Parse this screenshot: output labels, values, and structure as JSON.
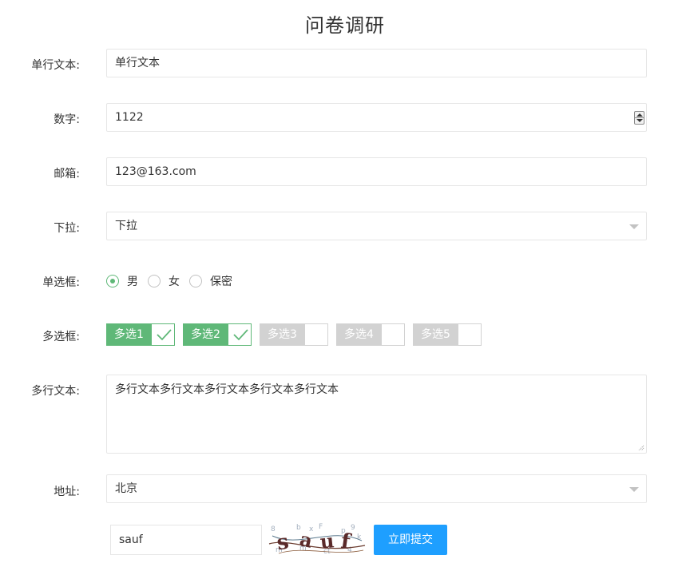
{
  "form": {
    "title": "问卷调研",
    "single_line": {
      "label": "单行文本:",
      "value": "单行文本"
    },
    "number": {
      "label": "数字:",
      "value": "1122"
    },
    "email": {
      "label": "邮箱:",
      "value": "123@163.com"
    },
    "dropdown": {
      "label": "下拉:",
      "selected": "下拉"
    },
    "radio": {
      "label": "单选框:",
      "options": [
        {
          "label": "男",
          "checked": true
        },
        {
          "label": "女",
          "checked": false
        },
        {
          "label": "保密",
          "checked": false
        }
      ]
    },
    "checkbox": {
      "label": "多选框:",
      "options": [
        {
          "label": "多选1",
          "checked": true
        },
        {
          "label": "多选2",
          "checked": true
        },
        {
          "label": "多选3",
          "checked": false
        },
        {
          "label": "多选4",
          "checked": false
        },
        {
          "label": "多选5",
          "checked": false
        }
      ]
    },
    "multiline": {
      "label": "多行文本:",
      "value": "多行文本多行文本多行文本多行文本多行文本"
    },
    "address": {
      "label": "地址:",
      "selected": "北京"
    },
    "captcha": {
      "value": "sauf",
      "image_text": "sauf"
    },
    "submit_label": "立即提交"
  },
  "colors": {
    "checked": "#5fb878",
    "unchecked": "#d2d2d2",
    "button": "#1e9fff",
    "border": "#e6e6e6"
  },
  "icons": {
    "spinner": "spinner-icon",
    "caret": "caret-down-icon",
    "check": "check-icon",
    "resize": "resize-grip-icon"
  }
}
